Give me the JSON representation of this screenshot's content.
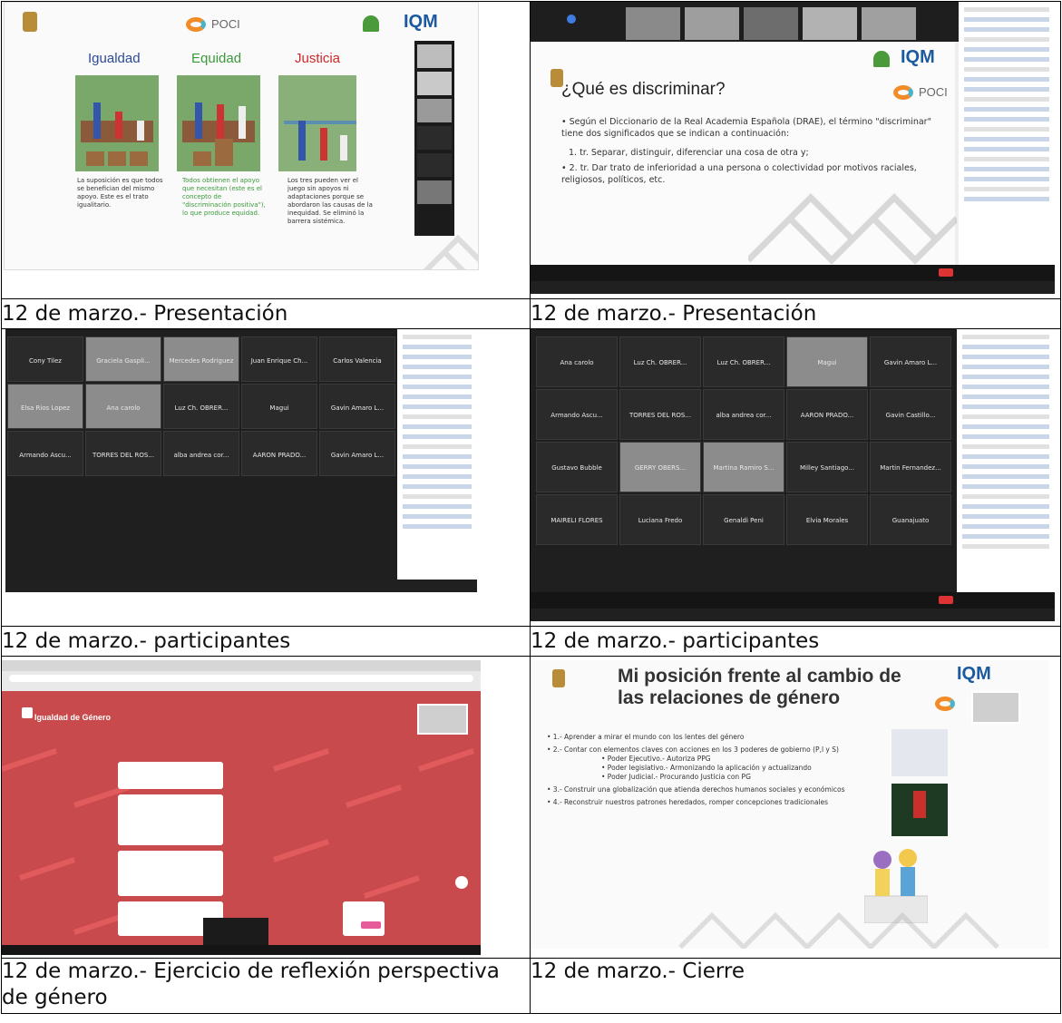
{
  "captions": {
    "c1": "12 de marzo.- Presentación",
    "c2": "12 de marzo.- Presentación",
    "c3": "12 de marzo.- participantes",
    "c4": "12 de marzo.- participantes",
    "c5": "12 de marzo.- Ejercicio de reflexión perspectiva de género",
    "c6": "12 de marzo.- Cierre"
  },
  "slide1": {
    "logo_poci": "POCI",
    "logo_iqm": "IQM",
    "col_igualdad": "Igualdad",
    "col_equidad": "Equidad",
    "col_justicia": "Justicia",
    "txt_igualdad": "La suposición es que todos se benefician del mismo apoyo. Este es el trato igualitario.",
    "txt_equidad": "Todos obtienen el apoyo que necesitan (este es el concepto de \"discriminación positiva\"), lo que produce equidad.",
    "txt_justicia": "Los tres pueden ver el juego sin apoyos ni adaptaciones porque se abordaron las causas de la inequidad. Se eliminó la barrera sistémica."
  },
  "slide2": {
    "logo_iqm": "IQM",
    "logo_poci": "POCI",
    "title": "¿Qué es discriminar?",
    "bullet1": "• Según el Diccionario de la Real Academia Española (DRAE), el término \"discriminar\" tiene dos significados que se indican a continuación:",
    "item1": "1. tr. Separar, distinguir, diferenciar una cosa de otra y;",
    "item2": "• 2. tr. Dar trato de inferioridad a una persona o colectividad por motivos raciales, religiosos, políticos, etc."
  },
  "grid3": {
    "names": [
      "Cony Tilez",
      "Graciela Gaspli...",
      "Mercedes Rodriguez",
      "Juan Enrique Ch...",
      "Carlos Valencia",
      "Elsa Rios Lopez",
      "Ana carolo",
      "Luz Ch. OBRER...",
      "Magui",
      "Gavin Amaro L...",
      "Armando Ascu...",
      "TORRES DEL ROS...",
      "alba andrea cor...",
      "AARON PRADO...",
      "Gavin Amaro L..."
    ]
  },
  "grid4": {
    "names": [
      "Ana carolo",
      "Luz Ch. OBRER...",
      "Luz Ch. OBRER...",
      "Magui",
      "Gavin Amaro L...",
      "Armando Ascu...",
      "TORRES DEL ROS...",
      "alba andrea cor...",
      "AARON PRADO...",
      "Gavin Castillo...",
      "Gustavo Bubble",
      "GERRY OBERS...",
      "Martina Ramiro S...",
      "Milley Santiago...",
      "Martin Fernandez...",
      "MAIRELI FLORES",
      "Luciana Fredo",
      "Genaldi Peni",
      "Elvia Morales",
      "Guanajuato"
    ]
  },
  "slide5": {
    "board_title": "Igualdad de Género"
  },
  "slide6": {
    "title": "Mi posición frente al cambio de las relaciones de género",
    "logo_iqm": "IQM",
    "b1": "• 1.- Aprender a mirar el mundo con los lentes del género",
    "b2": "• 2.- Contar con elementos claves con acciones en los 3 poderes de gobierno (P,l y S)",
    "b2a": "• Poder Ejecutivo.- Autoriza PPG",
    "b2b": "• Poder legislativo.- Armonizando la aplicación y actualizando",
    "b2c": "• Poder Judicial.- Procurando Justicia con PG",
    "b3": "• 3.- Construir una globalización que atienda derechos humanos sociales y económicos",
    "b4": "• 4.- Reconstruir nuestros patrones heredados, romper concepciones tradicionales"
  },
  "colors": {
    "iqm_blue": "#1c5a9f",
    "igualdad_blue": "#2c4a9a",
    "equidad_green": "#3a9a3a",
    "justicia_red": "#d02828",
    "board_red": "#c94a4c"
  }
}
